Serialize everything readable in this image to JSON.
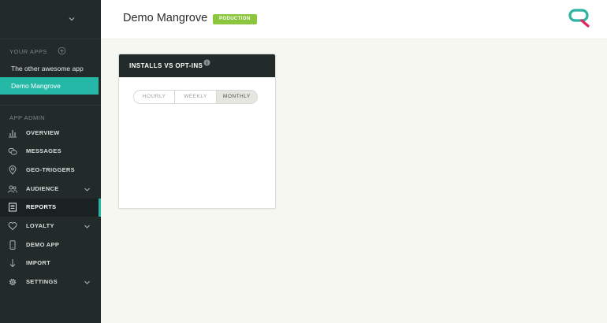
{
  "header": {
    "title": "Demo Mangrove",
    "environment_badge": "PODUCTION"
  },
  "sidebar": {
    "apps_section_label": "YOUR APPS",
    "apps": [
      {
        "label": "The other awesome app",
        "active": false
      },
      {
        "label": "Demo Mangrove",
        "active": true
      }
    ],
    "admin_section_label": "APP ADMIN",
    "nav_items": [
      {
        "label": "OVERVIEW",
        "icon": "bar-chart-icon",
        "expandable": false,
        "active": false
      },
      {
        "label": "MESSAGES",
        "icon": "messages-icon",
        "expandable": false,
        "active": false
      },
      {
        "label": "GEO-TRIGGERS",
        "icon": "location-pin-icon",
        "expandable": false,
        "active": false
      },
      {
        "label": "AUDIENCE",
        "icon": "audience-icon",
        "expandable": true,
        "active": false
      },
      {
        "label": "REPORTS",
        "icon": "report-icon",
        "expandable": false,
        "active": true
      },
      {
        "label": "LOYALTY",
        "icon": "heart-icon",
        "expandable": true,
        "active": false
      },
      {
        "label": "DEMO APP",
        "icon": "phone-icon",
        "expandable": false,
        "active": false
      },
      {
        "label": "IMPORT",
        "icon": "import-arrow-icon",
        "expandable": false,
        "active": false
      },
      {
        "label": "SETTINGS",
        "icon": "gear-icon",
        "expandable": true,
        "active": false
      }
    ]
  },
  "report_card": {
    "title": "INSTALLS VS OPT-INS",
    "periods": [
      {
        "label": "HOURLY",
        "active": false
      },
      {
        "label": "WEEKLY",
        "active": false
      },
      {
        "label": "MONTHLY",
        "active": true
      }
    ]
  },
  "colors": {
    "sidebar_bg": "#222b29",
    "accent_teal": "#25b8a6",
    "badge_green": "#8cc63f",
    "logo_teal": "#2bb3a4",
    "logo_red": "#e0245e"
  }
}
